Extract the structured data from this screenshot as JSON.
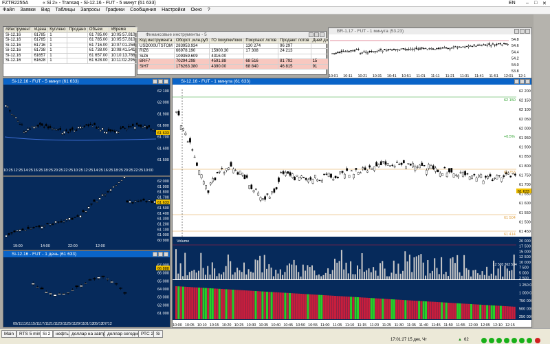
{
  "titlebar": {
    "left": "FZTR2255A",
    "mid": "« Si 2» - Transaq - Si-12.16 - FUT - 5 минут (61 633)",
    "lang": "EN"
  },
  "menu": [
    "Файл",
    "Заявки",
    "Вид",
    "Таблицы",
    "Запросы",
    "Графики",
    "Сообщения",
    "Настройки",
    "Окно",
    "?"
  ],
  "trades": {
    "headers": [
      "#Инструмент",
      "#Цена",
      "Куплено",
      "Продано",
      "Объем",
      "#Время"
    ],
    "rows": [
      [
        "Si-12.16",
        "61785",
        "1",
        "",
        "61 785.00",
        "10:05:57.810"
      ],
      [
        "Si-12.16",
        "61785",
        "1",
        "",
        "61 785.00",
        "10:05:57.810"
      ],
      [
        "Si-12.16",
        "61716",
        "1",
        "",
        "61 716.00",
        "10:07:01.258"
      ],
      [
        "Si-12.16",
        "61738",
        "1",
        "",
        "61 738.00",
        "10:08:41.541"
      ],
      [
        "Si-12.16",
        "61657",
        "1",
        "",
        "61 657.00",
        "10:10:13.766"
      ],
      [
        "Si-12.16",
        "61628",
        "1",
        "",
        "61 628.00",
        "10:11:02.295"
      ]
    ]
  },
  "fin": {
    "title": "Финансовые инструменты - 5",
    "headers": [
      "Код инструмента",
      "Оборот ,млн.руб",
      "ГО покупки/поко",
      "Покупают лотов",
      "Продают лотов",
      "Дней до погаш"
    ],
    "rows": [
      [
        "USD000UTSTOM",
        "283953.934",
        "",
        "130 274",
        "96 297",
        ""
      ],
      [
        "RIZ6",
        "66978.190",
        "15900.30",
        "17 308",
        "24 213",
        ""
      ],
      [
        "SiZ6",
        "109359.609",
        "4316.00",
        "",
        "",
        ""
      ],
      [
        "BRF7",
        "70294.298",
        "4591.88",
        "68 516",
        "81 792",
        "15"
      ],
      [
        "SiH7",
        "176263.380",
        "4390.00",
        "68 840",
        "46 815",
        "91"
      ]
    ]
  },
  "br": {
    "title": "BR-1.17 - FUT - 1 минута (53.23)",
    "prices": [
      "54.8",
      "54.6",
      "54.4",
      "54.2",
      "54.0",
      "53.8"
    ],
    "times": [
      "10:01",
      "10:11",
      "10:21",
      "10:31",
      "10:41",
      "10:51",
      "11:01",
      "11:11",
      "11:21",
      "11:31",
      "11:41",
      "11:51",
      "12:01",
      "12:1"
    ]
  },
  "si5": {
    "title": "Si-12.16 - FUT - 5 минут (61 633)",
    "prices": [
      "62 100",
      "62 000",
      "61 900",
      "61 800",
      "61 700",
      "61 600",
      "61 500"
    ],
    "tag": "61 633",
    "times": [
      "10:25",
      "12:25",
      "14:25",
      "16:25",
      "18:25",
      "20:25",
      "22:25",
      "10:25",
      "12:25",
      "14:25",
      "16:25",
      "18:25",
      "20:25",
      "22:25",
      "10:00"
    ]
  },
  "si60": {
    "prices": [
      "62 000",
      "61 900",
      "61 800",
      "61 700",
      "61 600",
      "61 500",
      "61 400",
      "61 300",
      "61 200",
      "61 100",
      "61 000",
      "60 900"
    ],
    "tag": "61 633",
    "times": [
      "19:00",
      "14:00",
      "22:00",
      "12:00"
    ]
  },
  "siday": {
    "title": "Si-12.16 - FUT - 1 день (61 633)",
    "prices": [
      "67 000",
      "66 000",
      "65 000",
      "64 000",
      "63 000",
      "62 000",
      "61 000"
    ],
    "tag": "66 888",
    "times": [
      "09/11",
      "11/11",
      "15/11",
      "17/11",
      "21/11",
      "23/11",
      "25/11",
      "29/11",
      "01/12",
      "05/12",
      "07/12"
    ]
  },
  "si1": {
    "title": "Si-12.16 - FUT - 1 минута (61 633)",
    "prices": [
      "62 200",
      "62 150",
      "62 100",
      "62 050",
      "62 000",
      "61 950",
      "61 900",
      "61 850",
      "61 800",
      "61 750",
      "61 700",
      "61 650",
      "61 600",
      "61 550",
      "61 500",
      "61 450"
    ],
    "levels": [
      "62 150",
      "+0.5%",
      "61 753",
      "61 504",
      "61 414"
    ],
    "tag": "61 633",
    "vol_label": "Volume",
    "vol_axis": [
      "20 000",
      "17 500",
      "15 000",
      "12 500",
      "10 000",
      "7 500",
      "5 000",
      "2 500"
    ],
    "vol_tag": "12 503 362 534",
    "ind_axis": [
      "1 250 000",
      "1 000 000",
      "750 000",
      "500 000",
      "250 000"
    ],
    "times": [
      "10:00",
      "10:05",
      "10:10",
      "10:15",
      "10:20",
      "10:25",
      "10:30",
      "10:35",
      "10:40",
      "10:45",
      "10:50",
      "10:55",
      "11:00",
      "11:05",
      "11:10",
      "11:15",
      "11:20",
      "11:25",
      "11:30",
      "11:35",
      "11:40",
      "11:45",
      "11:50",
      "11:55",
      "12:00",
      "12:05",
      "12:10",
      "12:15"
    ]
  },
  "tabs": [
    "Main",
    "RTS 5 min",
    "Si 2",
    "нефть",
    "доллар на завтра",
    "доллар сегодня",
    "РТС 2",
    "Si"
  ],
  "status": {
    "time": "17:01:27  15 дек, Чт",
    "count": "62"
  },
  "colors": {
    "pane": "#062a5b",
    "up": "#ffffff",
    "down": "#000000",
    "vol": "#c8c8c8",
    "red": "#c81e3c",
    "green": "#28d028"
  }
}
